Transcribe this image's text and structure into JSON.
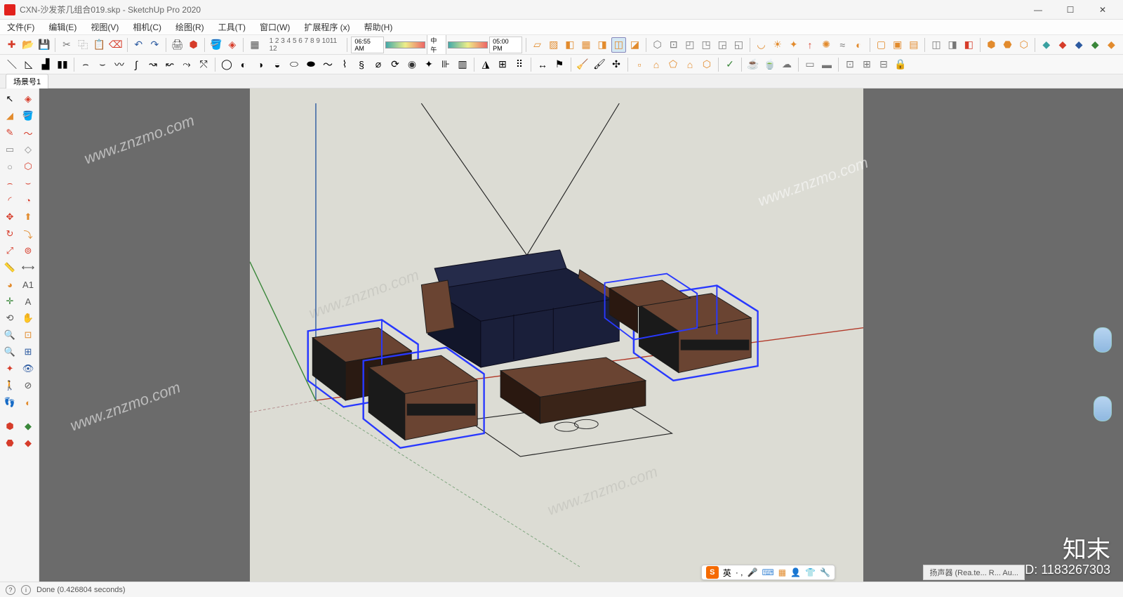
{
  "title": {
    "filename": "CXN-沙发茶几组合019.skp",
    "app": "SketchUp Pro 2020"
  },
  "menu": {
    "file": "文件(F)",
    "edit": "编辑(E)",
    "view": "视图(V)",
    "camera": "相机(C)",
    "draw": "绘图(R)",
    "tools": "工具(T)",
    "window": "窗口(W)",
    "extensions": "扩展程序 (x)",
    "help": "帮助(H)"
  },
  "numbers": "1 2 3 4 5 6 7 8 9 1011 12",
  "time": {
    "t1": "06:55 AM",
    "mid": "中午",
    "t2": "05:00 PM"
  },
  "scene": {
    "tab": "场景号1"
  },
  "status": {
    "done": "Done (0.426804 seconds)"
  },
  "ime": {
    "label": "英",
    "dots": "· ,"
  },
  "right_status": "扬声器 (Rea.te... R... Au...",
  "watermark": {
    "text": "www.znzmo.com",
    "logo": "知末",
    "id": "ID: 1183267303"
  },
  "tb1": {
    "i1": "new-icon",
    "i2": "open-icon",
    "i3": "save-icon",
    "i4": "cut-icon",
    "i5": "paste-icon",
    "i6": "erase-icon",
    "i7": "undo-icon",
    "i8": "redo-icon",
    "i9": "print-icon",
    "i10": "model-icon",
    "i11": "paint-icon",
    "i12": "match-icon",
    "i13": "calc-icon"
  },
  "styles": {
    "i1": "wire-icon",
    "i2": "hidden-icon",
    "i3": "shaded-icon",
    "i4": "texture-icon",
    "i5": "mono-icon",
    "i6": "xray-icon",
    "i7": "back-icon"
  },
  "nav": {
    "i1": "iso-icon",
    "i2": "top-icon",
    "i3": "front-icon",
    "i4": "right-icon",
    "i5": "back-icon",
    "i6": "left-icon"
  },
  "misc": {
    "arc": "arc-icon",
    "sun": "sun-icon",
    "fog": "fog-icon",
    "sec1": "section-icon",
    "sec2": "section-fill-icon",
    "sec3": "section-cut-icon"
  },
  "colors": {
    "red": "#d63c2a",
    "blue": "#2c5aa0",
    "green": "#3a873a",
    "orange": "#e28b2d",
    "purple": "#8a4a9a",
    "teal": "#3aa0a0",
    "gray": "#777",
    "dark": "#333"
  }
}
